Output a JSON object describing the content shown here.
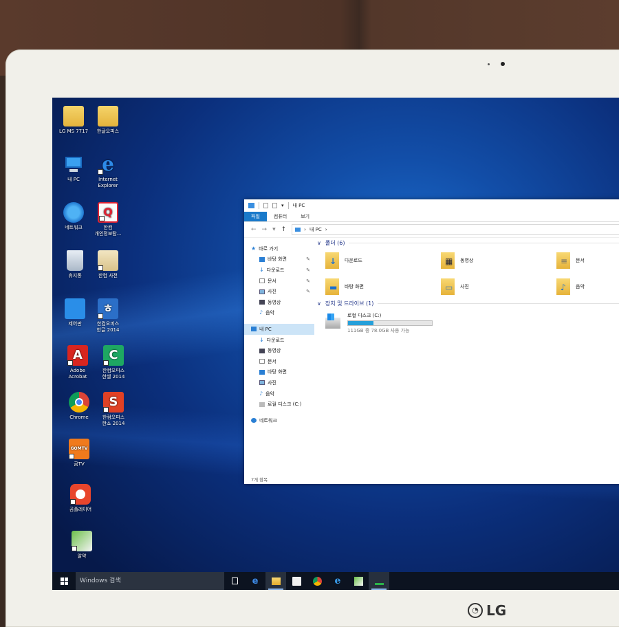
{
  "monitor": {
    "brand": "LG"
  },
  "desktop": {
    "icons": [
      {
        "name": "lg-ms-icon",
        "label": "LG MS 7717",
        "icon": "folder-user-icon"
      },
      {
        "name": "hancom-office-folder-icon",
        "label": "한글오피스",
        "icon": "folder-documents-icon"
      },
      {
        "name": "my-pc-icon",
        "label": "내 PC",
        "icon": "computer-icon"
      },
      {
        "name": "internet-explorer-icon",
        "label": "Internet\nExplorer",
        "icon": "internet-explorer-icon"
      },
      {
        "name": "network-icon",
        "label": "네트워크",
        "icon": "network-globe-icon"
      },
      {
        "name": "hancom-privacy-icon",
        "label": "한컴\n개인정보탐...",
        "icon": "magnifier-document-icon"
      },
      {
        "name": "recycle-bin-icon",
        "label": "휴지통",
        "icon": "trash-icon"
      },
      {
        "name": "hancom-photo-icon",
        "label": "한컴 사전",
        "icon": "dictionary-icon"
      },
      {
        "name": "control-panel-icon",
        "label": "제어판",
        "icon": "control-panel-icon"
      },
      {
        "name": "hancom-hangul-icon",
        "label": "한컴오피스\n한글 2014",
        "icon": "hwp-icon"
      },
      {
        "name": "adobe-acrobat-icon",
        "label": "Adobe\nAcrobat",
        "icon": "acrobat-icon"
      },
      {
        "name": "hancom-cell-icon",
        "label": "한컴오피스\n한셀 2014",
        "icon": "cell-icon"
      },
      {
        "name": "chrome-icon",
        "label": "Chrome",
        "icon": "chrome-icon"
      },
      {
        "name": "hancom-show-icon",
        "label": "한컴오피스\n한쇼 2014",
        "icon": "show-icon"
      },
      {
        "name": "gomtv-icon",
        "label": "곰TV",
        "icon": "gomtv-icon"
      },
      {
        "name": "gomplayer-icon",
        "label": "곰플레이어",
        "icon": "gomplayer-icon"
      },
      {
        "name": "alzip-icon",
        "label": "알약",
        "icon": "alyac-icon"
      }
    ]
  },
  "explorer": {
    "title": "내 PC",
    "tabs": [
      "파일",
      "컴퓨터",
      "보기"
    ],
    "breadcrumb": "내 PC",
    "nav": {
      "quick_access": "바로 가기",
      "quick_items": [
        "바탕 화면",
        "다운로드",
        "문서",
        "사진",
        "동영상",
        "음악"
      ],
      "this_pc": "내 PC",
      "pc_items": [
        "다운로드",
        "동영상",
        "문서",
        "바탕 화면",
        "사진",
        "음악",
        "로컬 디스크 (C:)"
      ],
      "network": "네트워크"
    },
    "folders_header": "폴더 (6)",
    "folders": [
      "다운로드",
      "동영상",
      "문서",
      "바탕 화면",
      "사진",
      "음악"
    ],
    "drives_header": "장치 및 드라이브 (1)",
    "drive": {
      "name": "로컬 디스크 (C:)",
      "free_text": "111GB 중 78.0GB 사용 가능",
      "used_fraction": 0.3
    },
    "status": "7개 항목"
  },
  "taskbar": {
    "search_placeholder": "Windows 검색"
  }
}
